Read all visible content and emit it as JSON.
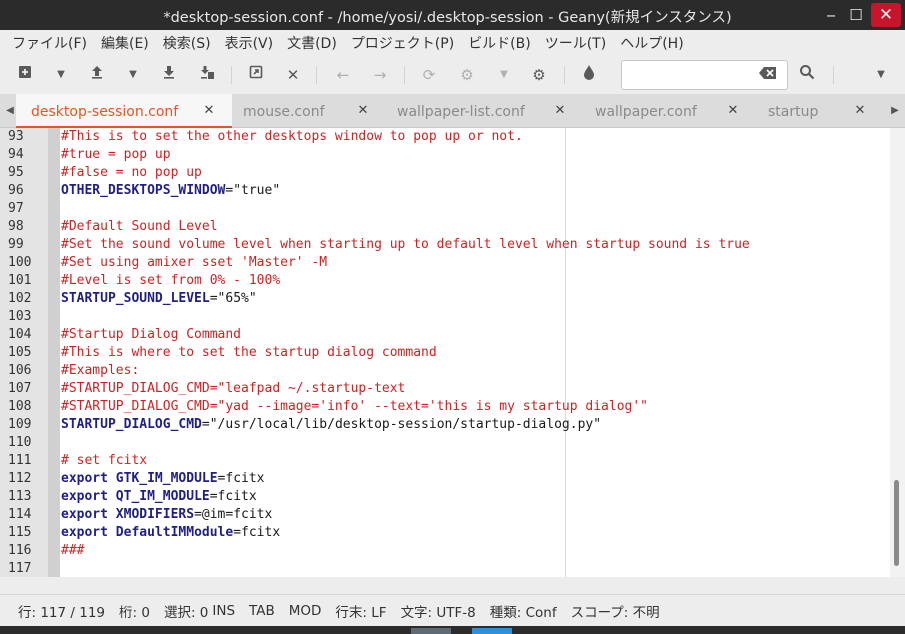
{
  "window": {
    "title": "*desktop-session.conf - /home/yosi/.desktop-session - Geany(新規インスタンス)",
    "min_label": "‒",
    "max_label": "☐",
    "close_label": "✕"
  },
  "menu": [
    "ファイル(F)",
    "編集(E)",
    "検索(S)",
    "表示(V)",
    "文書(D)",
    "プロジェクト(P)",
    "ビルド(B)",
    "ツール(T)",
    "ヘルプ(H)"
  ],
  "toolbar": {
    "search_value": "",
    "icons": [
      "new-file-icon",
      "open-file-icon",
      "save-icon",
      "save-all-icon",
      "revert-icon",
      "close-icon",
      "back-icon",
      "forward-icon",
      "compile-icon",
      "build-icon",
      "execute-icon",
      "color-picker-icon",
      "search-icon",
      "overflow-icon"
    ]
  },
  "tabs": [
    {
      "label": "desktop-session.conf",
      "active": true
    },
    {
      "label": "mouse.conf",
      "active": false
    },
    {
      "label": "wallpaper-list.conf",
      "active": false
    },
    {
      "label": "wallpaper.conf",
      "active": false
    },
    {
      "label": "startup",
      "active": false
    }
  ],
  "editor": {
    "lines": [
      {
        "n": "93",
        "parts": [
          {
            "t": "#This is to set the other desktops window to pop up or not.",
            "c": "comment"
          }
        ]
      },
      {
        "n": "94",
        "parts": [
          {
            "t": "#true = pop up",
            "c": "comment"
          }
        ]
      },
      {
        "n": "95",
        "parts": [
          {
            "t": "#false = no pop up",
            "c": "comment"
          }
        ]
      },
      {
        "n": "96",
        "parts": [
          {
            "t": "OTHER_DESKTOPS_WINDOW",
            "c": "ident"
          },
          {
            "t": "=\"true\"",
            "c": "plain"
          }
        ]
      },
      {
        "n": "97",
        "parts": []
      },
      {
        "n": "98",
        "parts": [
          {
            "t": "#Default Sound Level",
            "c": "comment"
          }
        ]
      },
      {
        "n": "99",
        "parts": [
          {
            "t": "#Set the sound volume level when starting up to default level when startup sound is true",
            "c": "comment"
          }
        ]
      },
      {
        "n": "100",
        "parts": [
          {
            "t": "#Set using amixer sset 'Master' -M",
            "c": "comment"
          }
        ]
      },
      {
        "n": "101",
        "parts": [
          {
            "t": "#Level is set from 0% - 100%",
            "c": "comment"
          }
        ]
      },
      {
        "n": "102",
        "parts": [
          {
            "t": "STARTUP_SOUND_LEVEL",
            "c": "ident"
          },
          {
            "t": "=\"65%\"",
            "c": "plain"
          }
        ]
      },
      {
        "n": "103",
        "parts": []
      },
      {
        "n": "104",
        "parts": [
          {
            "t": "#Startup Dialog Command",
            "c": "comment"
          }
        ]
      },
      {
        "n": "105",
        "parts": [
          {
            "t": "#This is where to set the startup dialog command",
            "c": "comment"
          }
        ]
      },
      {
        "n": "106",
        "parts": [
          {
            "t": "#Examples:",
            "c": "comment"
          }
        ]
      },
      {
        "n": "107",
        "parts": [
          {
            "t": "#STARTUP_DIALOG_CMD=\"leafpad ~/.startup-text",
            "c": "comment"
          }
        ]
      },
      {
        "n": "108",
        "parts": [
          {
            "t": "#STARTUP_DIALOG_CMD=\"yad --image='info' --text='this is my startup dialog'\"",
            "c": "comment"
          }
        ]
      },
      {
        "n": "109",
        "parts": [
          {
            "t": "STARTUP_DIALOG_CMD",
            "c": "ident"
          },
          {
            "t": "=\"/usr/local/lib/desktop-session/startup-dialog.py\"",
            "c": "plain"
          }
        ]
      },
      {
        "n": "110",
        "parts": []
      },
      {
        "n": "111",
        "parts": [
          {
            "t": "# set fcitx",
            "c": "comment"
          }
        ]
      },
      {
        "n": "112",
        "parts": [
          {
            "t": "export ",
            "c": "kw"
          },
          {
            "t": "GTK_IM_MODULE",
            "c": "ident"
          },
          {
            "t": "=fcitx",
            "c": "plain"
          }
        ]
      },
      {
        "n": "113",
        "parts": [
          {
            "t": "export ",
            "c": "kw"
          },
          {
            "t": "QT_IM_MODULE",
            "c": "ident"
          },
          {
            "t": "=fcitx",
            "c": "plain"
          }
        ]
      },
      {
        "n": "114",
        "parts": [
          {
            "t": "export ",
            "c": "kw"
          },
          {
            "t": "XMODIFIERS",
            "c": "ident"
          },
          {
            "t": "=@im=fcitx",
            "c": "plain"
          }
        ]
      },
      {
        "n": "115",
        "parts": [
          {
            "t": "export ",
            "c": "kw"
          },
          {
            "t": "DefaultIMModule",
            "c": "ident"
          },
          {
            "t": "=fcitx",
            "c": "plain"
          }
        ]
      },
      {
        "n": "116",
        "parts": [
          {
            "t": "###",
            "c": "comment"
          }
        ]
      },
      {
        "n": "117",
        "parts": []
      }
    ]
  },
  "status": {
    "line": "行: 117 / 119",
    "col": "桁: 0",
    "sel": "選択: 0",
    "ins": "INS",
    "tab": "TAB",
    "mod": "MOD",
    "eol": "行末: LF",
    "encoding": "文字: UTF-8",
    "filetype": "種類: Conf",
    "scope": "スコープ: 不明"
  },
  "colors": {
    "accent": "#e95420",
    "comment": "#d42020",
    "identifier": "#1f1f8a"
  }
}
